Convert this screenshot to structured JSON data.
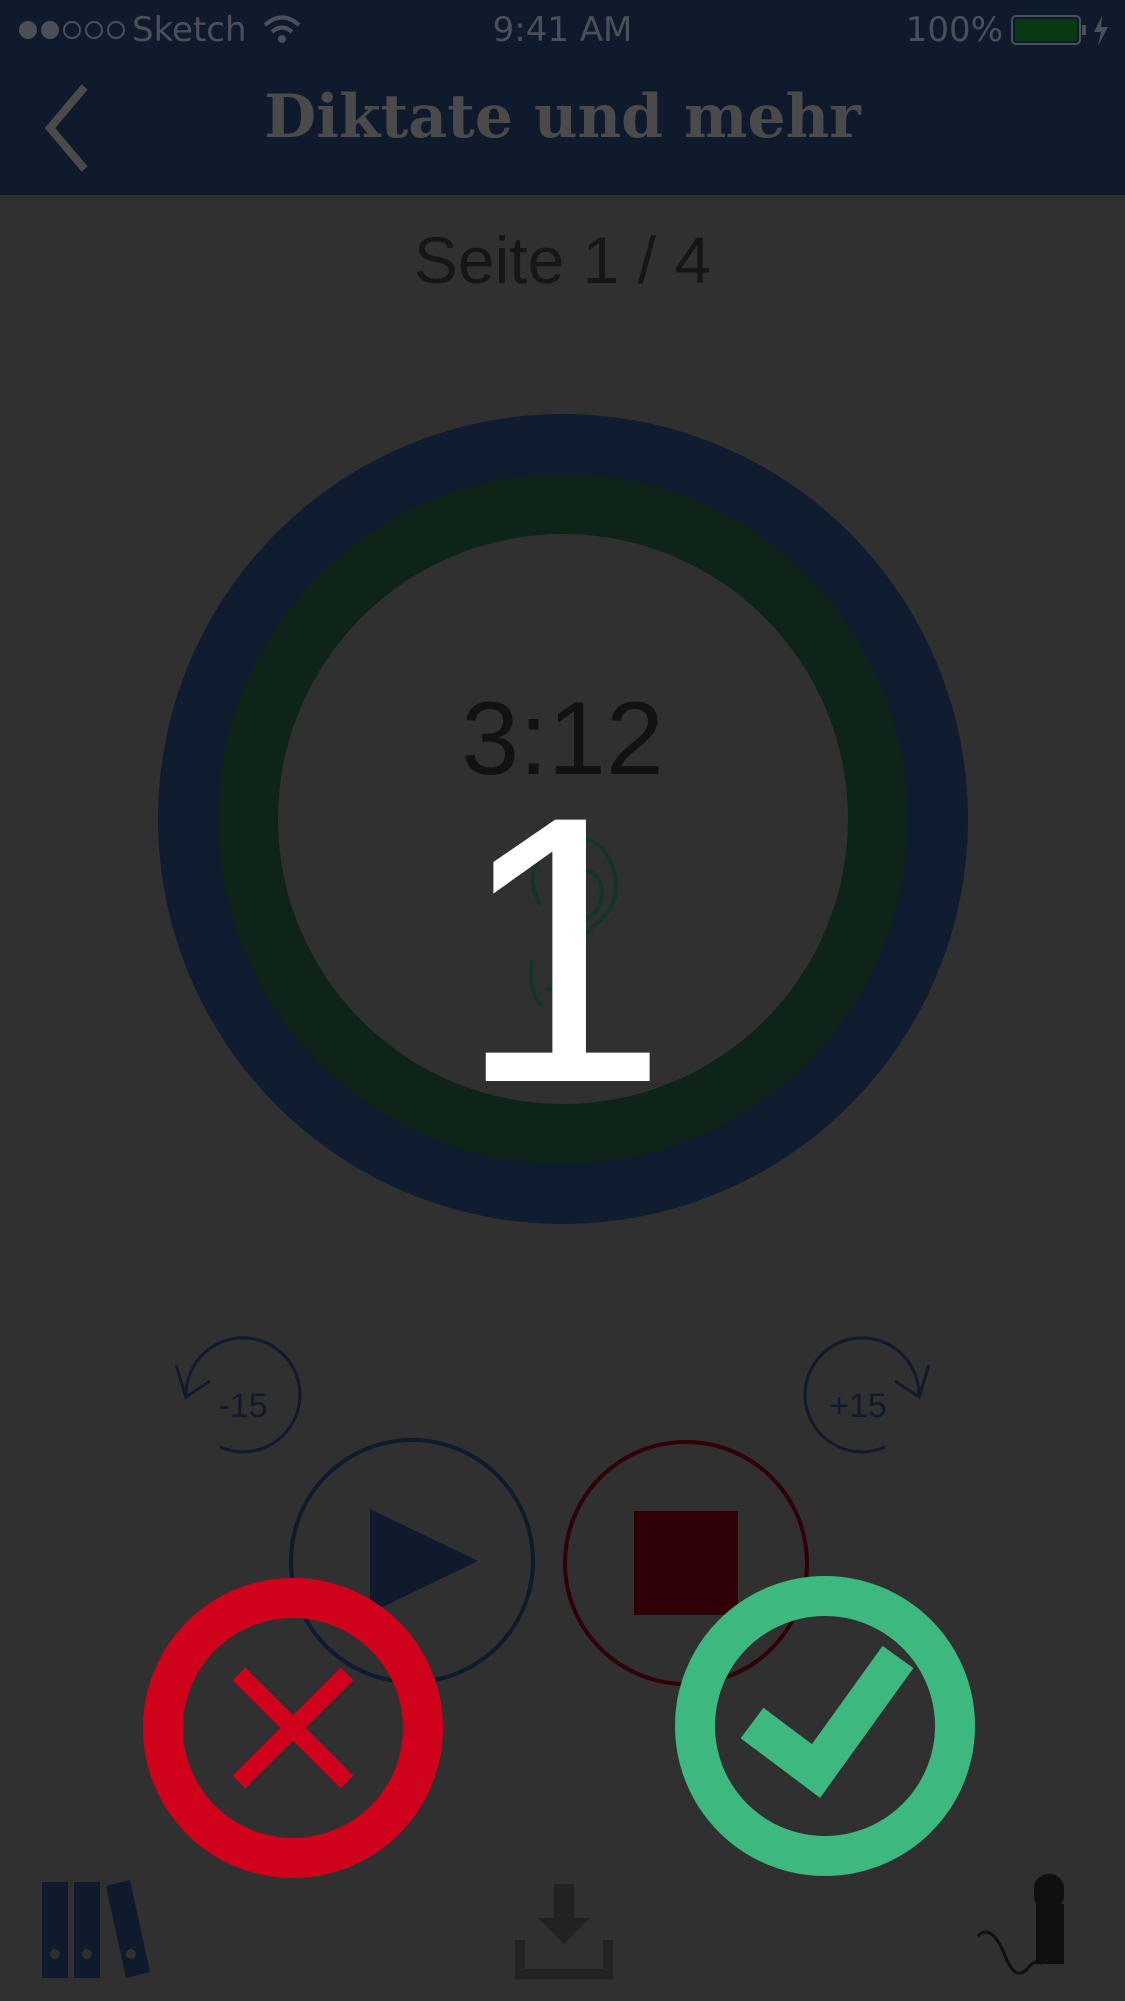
{
  "status_bar": {
    "carrier": "Sketch",
    "time": "9:41 AM",
    "battery": "100%"
  },
  "nav": {
    "title": "Diktate und mehr",
    "back_icon": "chevron-left-icon"
  },
  "page_indicator": "Seite 1 / 4",
  "player": {
    "time_remaining": "3:12",
    "center_icon": "ear-icon",
    "skip_back_label": "-15",
    "skip_forward_label": "+15",
    "play_icon": "play-icon",
    "stop_icon": "stop-icon"
  },
  "countdown_overlay": "1",
  "actions": {
    "reject_icon": "close-icon",
    "accept_icon": "checkmark-icon"
  },
  "tab_bar": {
    "library_icon": "books-icon",
    "download_icon": "download-icon",
    "record_icon": "microphone-icon"
  },
  "colors": {
    "background": "#303030",
    "navbar": "#0f1a2c",
    "outer_ring": "#101c30",
    "inner_ring": "#0e2419",
    "reject": "#d0021b",
    "accept": "#3db87f",
    "stop": "#300008"
  }
}
